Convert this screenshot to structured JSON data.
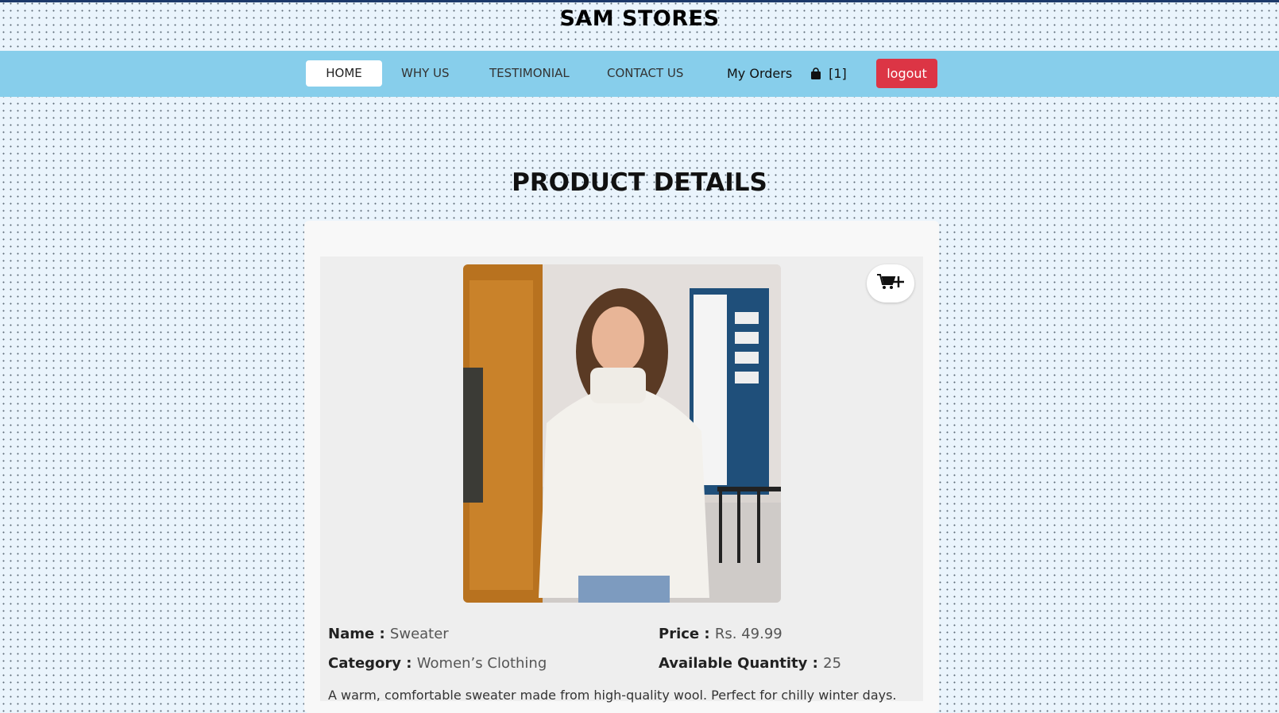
{
  "header": {
    "brand": "SAM STORES"
  },
  "nav": {
    "home": "HOME",
    "why_us": "WHY US",
    "testimonial": "TESTIMONIAL",
    "contact_us": "CONTACT US",
    "my_orders": "My Orders",
    "cart_count": "[1]",
    "logout": "logout"
  },
  "page": {
    "title": "PRODUCT DETAILS"
  },
  "product": {
    "name_label": "Name :",
    "name": "Sweater",
    "price_label": "Price :",
    "price": "Rs. 49.99",
    "category_label": "Category :",
    "category": "Women’s Clothing",
    "quantity_label": "Available Quantity :",
    "quantity": "25",
    "description": "A warm, comfortable sweater made from high-quality wool. Perfect for chilly winter days."
  },
  "icons": {
    "cart": "bag-icon",
    "add_to_cart": "cart-plus-icon"
  },
  "colors": {
    "navbar": "#87ceeb",
    "logout": "#dc3545"
  }
}
